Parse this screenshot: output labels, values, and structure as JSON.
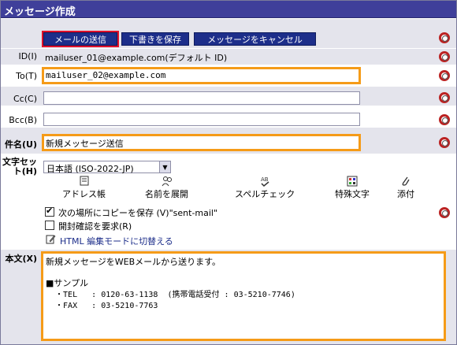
{
  "window": {
    "title": "メッセージ作成"
  },
  "toolbar": {
    "send_label": "メールの送信",
    "draft_label": "下書きを保存",
    "cancel_label": "メッセージをキャンセル"
  },
  "fields": {
    "id_label": "ID(I)",
    "id_value": "mailuser_01@example.com(デフォルト ID)",
    "to_label": "To(T)",
    "to_value": "mailuser_02@example.com",
    "cc_label": "Cc(C)",
    "cc_value": "",
    "bcc_label": "Bcc(B)",
    "bcc_value": "",
    "subject_label": "件名(U)",
    "subject_value": "新規メッセージ送信",
    "charset_label_line1": "文字セッ",
    "charset_label_line2": "ト(H)",
    "charset_value": "日本語 (ISO-2022-JP)"
  },
  "tools": {
    "address_book": "アドレス帳",
    "expand_names": "名前を展開",
    "spell_check": "スペルチェック",
    "special_chars": "特殊文字",
    "attach": "添付"
  },
  "options": {
    "save_copy_label": "次の場所にコピーを保存 (V)\"sent-mail\"",
    "save_copy_checked": true,
    "read_receipt_label": "開封確認を要求(R)",
    "read_receipt_checked": false,
    "html_mode_link": "HTML 編集モードに切替える"
  },
  "message_body": {
    "label": "本文(X)",
    "lines": [
      "新規メッセージをWEBメールから送ります。",
      "",
      "■サンプル",
      "  ・TEL   : 0120-63-1138  (携帯電話受付 : 03-5210-7746)",
      "  ・FAX   : 03-5210-7763"
    ]
  },
  "colors": {
    "titlebar": "#3f3f9a",
    "button": "#1d2e8a",
    "highlight_red": "#e0102a",
    "highlight_orange": "#f59b18",
    "panel_gray": "#e4e4ec"
  }
}
